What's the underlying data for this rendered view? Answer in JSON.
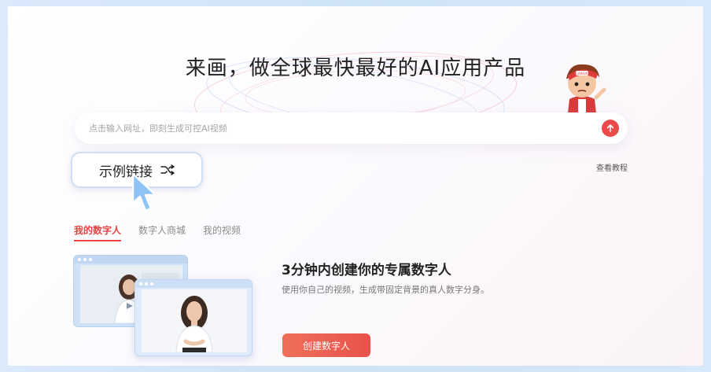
{
  "headline": "来画，做全球最快最好的AI应用产品",
  "search": {
    "placeholder": "点击输入网址，即刻生成可控AI视频",
    "value": ""
  },
  "tutorial_link": "查看教程",
  "example_button": {
    "label": "示例链接",
    "icon": "shuffle-icon"
  },
  "mascot": {
    "hat_text": "LAIHUA"
  },
  "tabs": [
    {
      "label": "我的数字人",
      "active": true
    },
    {
      "label": "数字人商城",
      "active": false
    },
    {
      "label": "我的视频",
      "active": false
    }
  ],
  "promo": {
    "title": "3分钟内创建你的专属数字人",
    "description": "使用你自己的视频，生成带固定背景的真人数字分身。",
    "button_label": "创建数字人"
  },
  "colors": {
    "accent": "#e84444",
    "button_gradient_start": "#ef6f5c",
    "button_gradient_end": "#e8524a",
    "frame_border": "#d6e8fa"
  }
}
